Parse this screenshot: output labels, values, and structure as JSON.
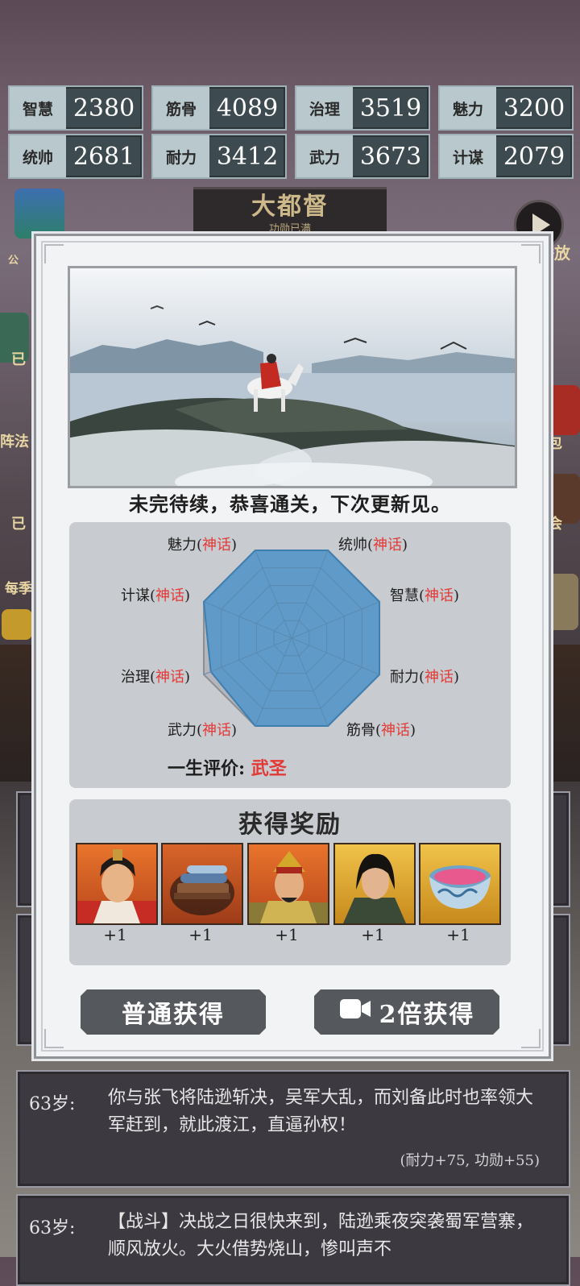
{
  "stats": [
    {
      "label": "智慧",
      "value": "2380"
    },
    {
      "label": "筋骨",
      "value": "4089"
    },
    {
      "label": "治理",
      "value": "3519"
    },
    {
      "label": "魅力",
      "value": "3200"
    },
    {
      "label": "统帅",
      "value": "2681"
    },
    {
      "label": "耐力",
      "value": "3412"
    },
    {
      "label": "武力",
      "value": "3673"
    },
    {
      "label": "计谋",
      "value": "2079"
    }
  ],
  "background": {
    "title": "大都督",
    "subtitle": "功勋已满",
    "play_label": "播放",
    "side_left": [
      "公",
      "已",
      "阵法",
      "已",
      "每季"
    ],
    "side_right": [
      "包",
      "会"
    ]
  },
  "modal": {
    "message": "未完待续，恭喜通关，下次更新见。",
    "radar": {
      "axes": [
        {
          "name": "统帅",
          "grade": "神话",
          "level": 1.0
        },
        {
          "name": "智慧",
          "grade": "神话",
          "level": 1.0
        },
        {
          "name": "耐力",
          "grade": "神话",
          "level": 1.0
        },
        {
          "name": "筋骨",
          "grade": "神话",
          "level": 1.0
        },
        {
          "name": "武力",
          "grade": "神话",
          "level": 1.0
        },
        {
          "name": "治理",
          "grade": "神话",
          "level": 1.0
        },
        {
          "name": "计谋",
          "grade": "神话",
          "level": 0.92
        },
        {
          "name": "魅力",
          "grade": "神话",
          "level": 1.0
        }
      ],
      "evaluation_label": "一生评价:",
      "evaluation_value": "武圣"
    },
    "rewards_title": "获得奖励",
    "rewards": [
      {
        "icon": "general-portrait-1",
        "count": "+1"
      },
      {
        "icon": "scroll-books-icon",
        "count": "+1"
      },
      {
        "icon": "general-portrait-2",
        "count": "+1"
      },
      {
        "icon": "general-portrait-3",
        "count": "+1"
      },
      {
        "icon": "porcelain-bowl-icon",
        "count": "+1"
      }
    ],
    "buttons": {
      "normal": "普通获得",
      "double": "2倍获得"
    }
  },
  "log": [
    {
      "age": "63岁:",
      "text": "你与张飞将陆逊斩决，吴军大乱，而刘备此时也率领大军赶到，就此渡江，直逼孙权！",
      "gain": "(耐力+75, 功勋+55)"
    },
    {
      "age": "63岁:",
      "text": "【战斗】决战之日很快来到，陆逊乘夜突袭蜀军营寨，顺风放火。大火借势烧山，惨叫声不"
    }
  ]
}
